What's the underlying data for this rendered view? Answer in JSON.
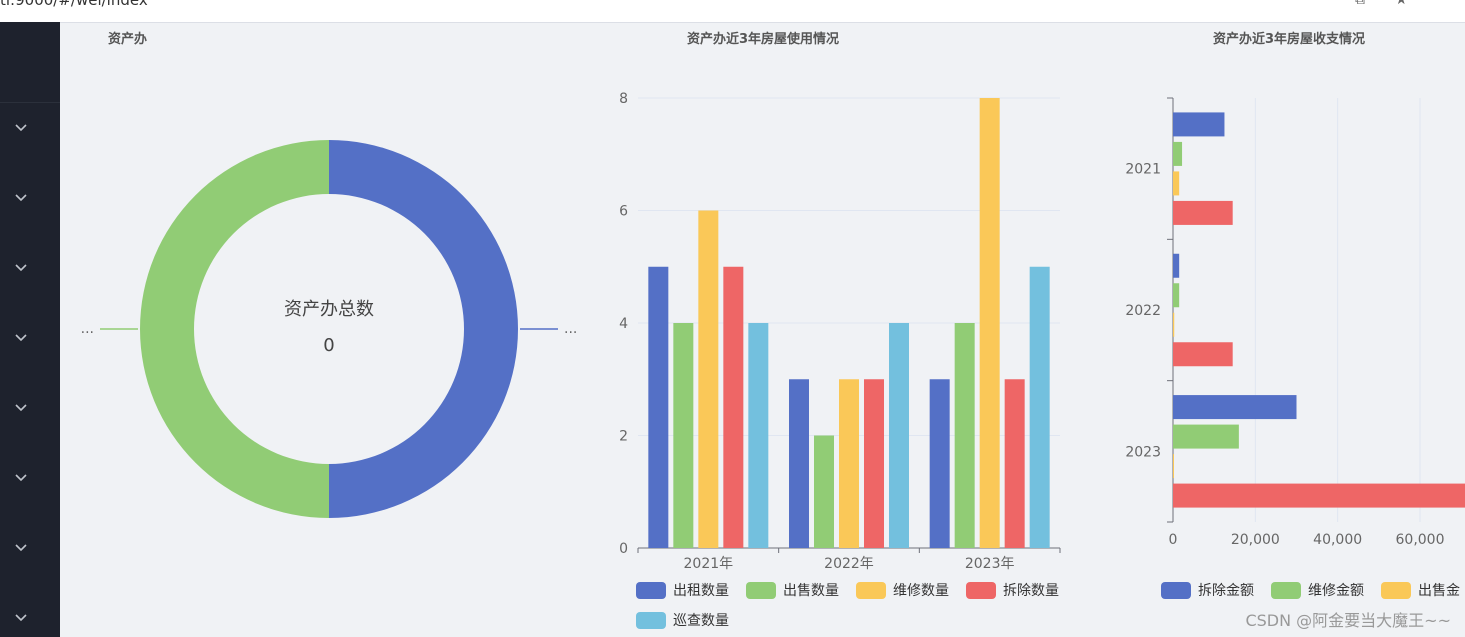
{
  "browser": {
    "url": "ti:9000/#/wel/index"
  },
  "sidebar": {
    "menu_count": 8
  },
  "panels": {
    "donut": {
      "title": "资产办"
    },
    "bar": {
      "title": "资产办近3年房屋使用情况"
    },
    "hbar": {
      "title": "资产办近3年房屋收支情况"
    }
  },
  "watermark": "CSDN @阿金要当大魔王~~",
  "chart_data": [
    {
      "type": "pie",
      "title": "资产办",
      "center_label": "资产办总数",
      "center_value": "0",
      "slices": [
        {
          "label": "...",
          "value": 1,
          "color": "#5470c6"
        },
        {
          "label": "...",
          "value": 1,
          "color": "#91cc75"
        }
      ]
    },
    {
      "type": "bar",
      "title": "资产办近3年房屋使用情况",
      "categories": [
        "2021年",
        "2022年",
        "2023年"
      ],
      "ylim": [
        0,
        8
      ],
      "yticks": [
        0,
        2,
        4,
        6,
        8
      ],
      "grid": true,
      "legend_position": "bottom",
      "series": [
        {
          "name": "出租数量",
          "values": [
            5,
            3,
            3
          ],
          "color": "#5470c6"
        },
        {
          "name": "出售数量",
          "values": [
            4,
            2,
            4
          ],
          "color": "#91cc75"
        },
        {
          "name": "维修数量",
          "values": [
            6,
            3,
            8
          ],
          "color": "#fac858"
        },
        {
          "name": "拆除数量",
          "values": [
            5,
            3,
            3
          ],
          "color": "#ee6666"
        },
        {
          "name": "巡查数量",
          "values": [
            4,
            4,
            5
          ],
          "color": "#73c0de"
        }
      ]
    },
    {
      "type": "bar",
      "orientation": "horizontal",
      "title": "资产办近3年房屋收支情况",
      "categories": [
        "2021",
        "2022",
        "2023"
      ],
      "xlim": [
        0,
        70000
      ],
      "xticks": [
        0,
        20000,
        40000,
        60000
      ],
      "xtick_labels": [
        "0",
        "20,000",
        "40,000",
        "60,000"
      ],
      "grid": true,
      "legend_position": "bottom",
      "series": [
        {
          "name": "拆除金额",
          "values": [
            12500,
            1500,
            30000
          ],
          "color": "#5470c6"
        },
        {
          "name": "维修金额",
          "values": [
            2200,
            1500,
            16000
          ],
          "color": "#91cc75"
        },
        {
          "name": "出售金",
          "values": [
            1500,
            300,
            200
          ],
          "color": "#fac858"
        },
        {
          "name": "",
          "values": [
            14500,
            14500,
            80000
          ],
          "color": "#ee6666"
        }
      ]
    }
  ]
}
